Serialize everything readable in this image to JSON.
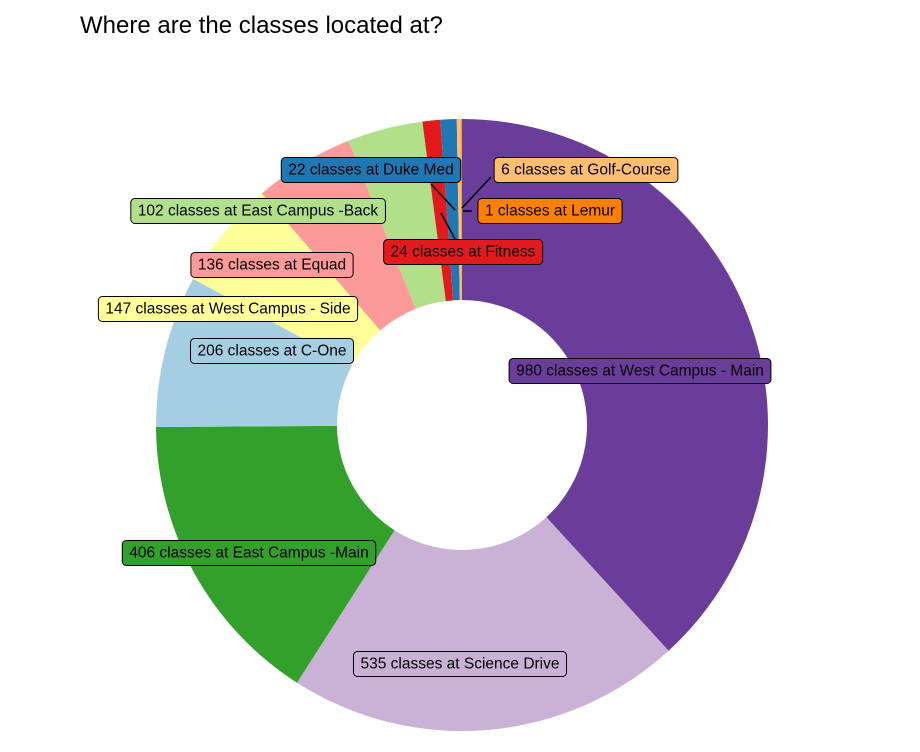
{
  "chart_data": {
    "type": "pie",
    "subtype": "donut",
    "title": "Where are the classes located at?",
    "slices": [
      {
        "name": "West Campus - Main",
        "value": 980,
        "color": "#6A3D9A",
        "label": "980 classes at West Campus - Main"
      },
      {
        "name": "Science Drive",
        "value": 535,
        "color": "#CAB2D6",
        "label": "535 classes at Science Drive"
      },
      {
        "name": "East Campus -Main",
        "value": 406,
        "color": "#33A02C",
        "label": "406 classes at East Campus -Main"
      },
      {
        "name": "C-One",
        "value": 206,
        "color": "#A6CEE3",
        "label": "206 classes at C-One"
      },
      {
        "name": "West Campus - Side",
        "value": 147,
        "color": "#FFFF99",
        "label": "147 classes at West Campus - Side"
      },
      {
        "name": "Equad",
        "value": 136,
        "color": "#FB9A99",
        "label": "136 classes at Equad"
      },
      {
        "name": "East Campus -Back",
        "value": 102,
        "color": "#B2DF8A",
        "label": "102 classes at East Campus -Back"
      },
      {
        "name": "Fitness",
        "value": 24,
        "color": "#E31A1C",
        "label": "24 classes at Fitness"
      },
      {
        "name": "Duke Med",
        "value": 22,
        "color": "#1F78B4",
        "label": "22 classes at Duke Med"
      },
      {
        "name": "Golf-Course",
        "value": 6,
        "color": "#FDBF6F",
        "label": "6 classes at Golf-Course"
      },
      {
        "name": "Lemur",
        "value": 1,
        "color": "#FF7F00",
        "label": "1 classes at Lemur"
      }
    ]
  }
}
